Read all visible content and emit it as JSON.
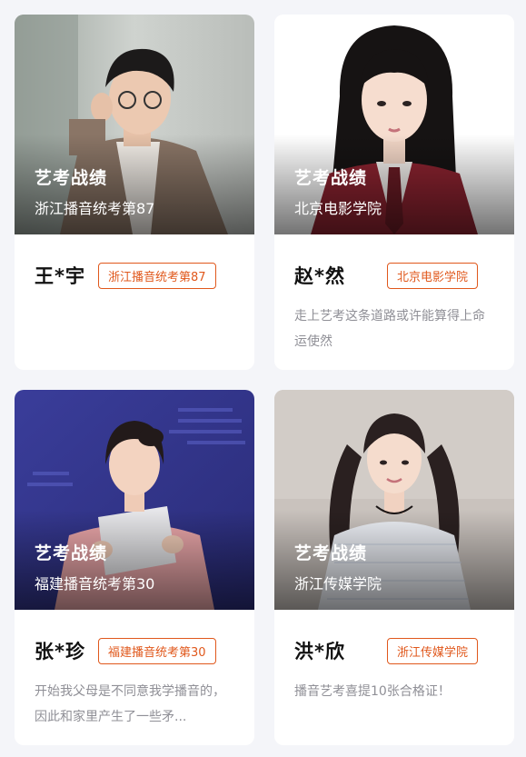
{
  "cards": [
    {
      "section_title": "艺考战绩",
      "achievement": "浙江播音统考第87",
      "name": "王*宇",
      "badge": "浙江播音统考第87",
      "quote": ""
    },
    {
      "section_title": "艺考战绩",
      "achievement": "北京电影学院",
      "name": "赵*然",
      "badge": "北京电影学院",
      "quote": "走上艺考这条道路或许能算得上命运使然"
    },
    {
      "section_title": "艺考战绩",
      "achievement": "福建播音统考第30",
      "name": "张*珍",
      "badge": "福建播音统考第30",
      "quote": "开始我父母是不同意我学播音的，因此和家里产生了一些矛..."
    },
    {
      "section_title": "艺考战绩",
      "achievement": "浙江传媒学院",
      "name": "洪*欣",
      "badge": "浙江传媒学院",
      "quote": "播音艺考喜提10张合格证！"
    }
  ],
  "colors": {
    "accent": "#e0581c",
    "page_bg": "#f4f5f9",
    "card_bg": "#ffffff",
    "quote_text": "#8f8f96"
  }
}
